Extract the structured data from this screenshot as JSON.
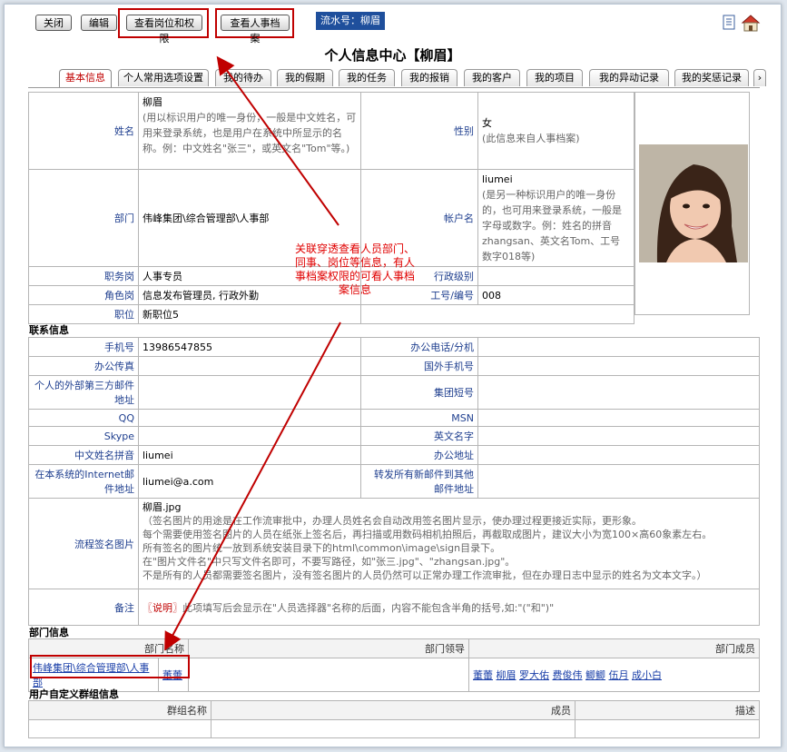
{
  "toolbar": {
    "close": "关闭",
    "edit": "编辑",
    "view_position": "查看岗位和权限",
    "view_hr": "查看人事档案",
    "serial": "流水号：柳眉"
  },
  "title": "个人信息中心【柳眉】",
  "tabs": [
    "基本信息",
    "个人常用选项设置",
    "我的待办",
    "我的假期",
    "我的任务",
    "我的报销",
    "我的客户",
    "我的项目",
    "我的异动记录",
    "我的奖惩记录"
  ],
  "tab_more": "›",
  "basic": {
    "name_label": "姓名",
    "name_value": "柳眉",
    "name_hint": "(用以标识用户的唯一身份，一般是中文姓名，可用来登录系统，也是用户在系统中所显示的名称。例：中文姓名\"张三\"，或英文名\"Tom\"等。)",
    "gender_label": "性别",
    "gender_value": "女",
    "gender_hint": "(此信息来自人事档案)",
    "dept_label": "部门",
    "dept_value": "伟峰集团\\综合管理部\\人事部",
    "account_label": "帐户名",
    "account_value": "liumei",
    "account_hint": "(是另一种标识用户的唯一身份的，也可用来登录系统，一般是字母或数字。例：姓名的拼音zhangsan、英文名Tom、工号数字018等)",
    "duty_label": "职务岗",
    "duty_value": "人事专员",
    "admin_level_label": "行政级别",
    "admin_level_value": "",
    "role_label": "角色岗",
    "role_value": "信息发布管理员, 行政外勤",
    "empno_label": "工号/编号",
    "empno_value": "008",
    "rank_label": "职位",
    "rank_value": "新职位5"
  },
  "contact": {
    "section": "联系信息",
    "mobile_label": "手机号",
    "mobile_value": "13986547855",
    "office_phone_label": "办公电话/分机",
    "office_fax_label": "办公传真",
    "foreign_mobile_label": "国外手机号",
    "external_mail_label": "个人的外部第三方邮件地址",
    "group_sms_label": "集团短号",
    "qq_label": "QQ",
    "msn_label": "MSN",
    "skype_label": "Skype",
    "english_name_label": "英文名字",
    "pinyin_label": "中文姓名拼音",
    "pinyin_value": "liumei",
    "office_addr_label": "办公地址",
    "internet_mail_label": "在本系统的Internet邮件地址",
    "internet_mail_value": "liumei@a.com",
    "forward_label": "转发所有新邮件到其他邮件地址",
    "sign_label": "流程签名图片",
    "sign_file": "柳眉.jpg",
    "sign_lines": [
      "（签名图片的用途是在工作流审批中，办理人员姓名会自动改用签名图片显示，使办理过程更接近实际，更形象。",
      "每个需要使用签名图片的人员在纸张上签名后，再扫描或用数码相机拍照后，再截取成图片，建议大小为宽100×高60象素左右。",
      "所有签名的图片统一放到系统安装目录下的html\\common\\image\\sign目录下。",
      "在\"图片文件名\"中只写文件名即可，不要写路径，如\"张三.jpg\"、\"zhangsan.jpg\"。",
      "不是所有的人员都需要签名图片，没有签名图片的人员仍然可以正常办理工作流审批，但在办理日志中显示的姓名为文本文字。）"
    ],
    "remark_label": "备注",
    "remark_tag": "〖说明〗",
    "remark_text": "此项填写后会显示在\"人员选择器\"名称的后面，内容不能包含半角的括号,如:\"(\"和\")\""
  },
  "dept": {
    "section": "部门信息",
    "headers": [
      "部门名称",
      "部门领导",
      "部门成员"
    ],
    "name": "伟峰集团\\综合管理部\\人事部",
    "leader": "董蕾",
    "members": [
      "董蕾",
      "柳眉",
      "罗大佑",
      "费俊伟",
      "鲫鲫",
      "伍月",
      "成小白"
    ]
  },
  "groups": {
    "section": "用户自定义群组信息",
    "headers": [
      "群组名称",
      "成员",
      "描述"
    ]
  },
  "annotation": "关联穿透查看人员部门、同事、岗位等信息，有人事档案权限的可看人事档案信息",
  "colors": {
    "accent_red": "#c00000",
    "link_blue": "#1a3fa8",
    "serial_bg": "#1f4f9c"
  }
}
